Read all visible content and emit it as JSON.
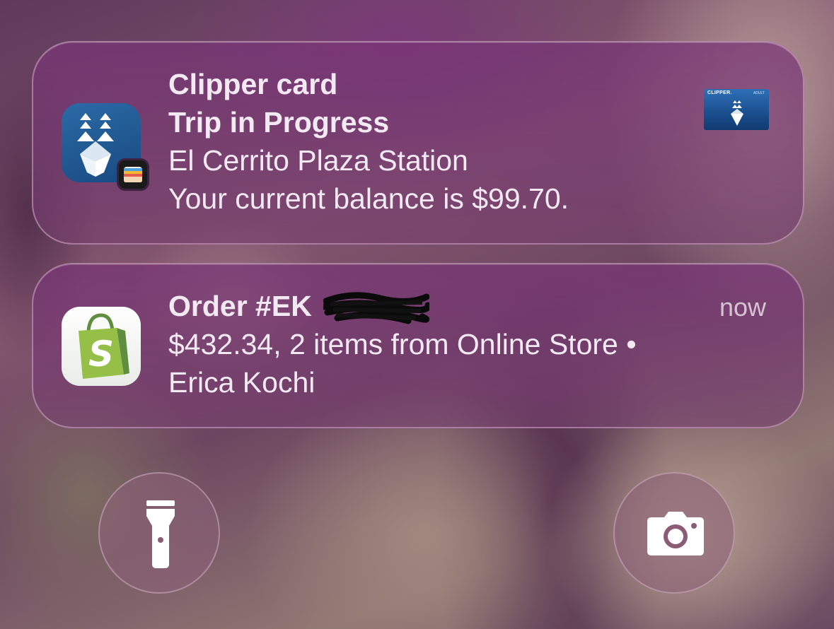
{
  "notifications": [
    {
      "app": "Clipper card",
      "title": "Trip in Progress",
      "body_line1": "El Cerrito Plaza Station",
      "body_line2": "Your current balance is $99.70.",
      "app_icon": "clipper-logo-icon",
      "badge_icon": "wallet-icon",
      "thumbnail": {
        "brand": "CLIPPER.",
        "type": "ADULT"
      }
    },
    {
      "title": "Order #EK",
      "title_redacted": true,
      "timestamp": "now",
      "body_line1": "$432.34, 2 items from Online Store •",
      "body_line2": "Erica Kochi",
      "app_icon": "shopify-bag-icon"
    }
  ],
  "lockscreen_buttons": [
    {
      "name": "flashlight",
      "icon": "flashlight-icon"
    },
    {
      "name": "camera",
      "icon": "camera-icon"
    }
  ],
  "colors": {
    "notification_bg": "#7a3a76",
    "text": "#f3e9f2",
    "clipper_blue": "#1f5a98",
    "shopify_green": "#7ab648"
  }
}
